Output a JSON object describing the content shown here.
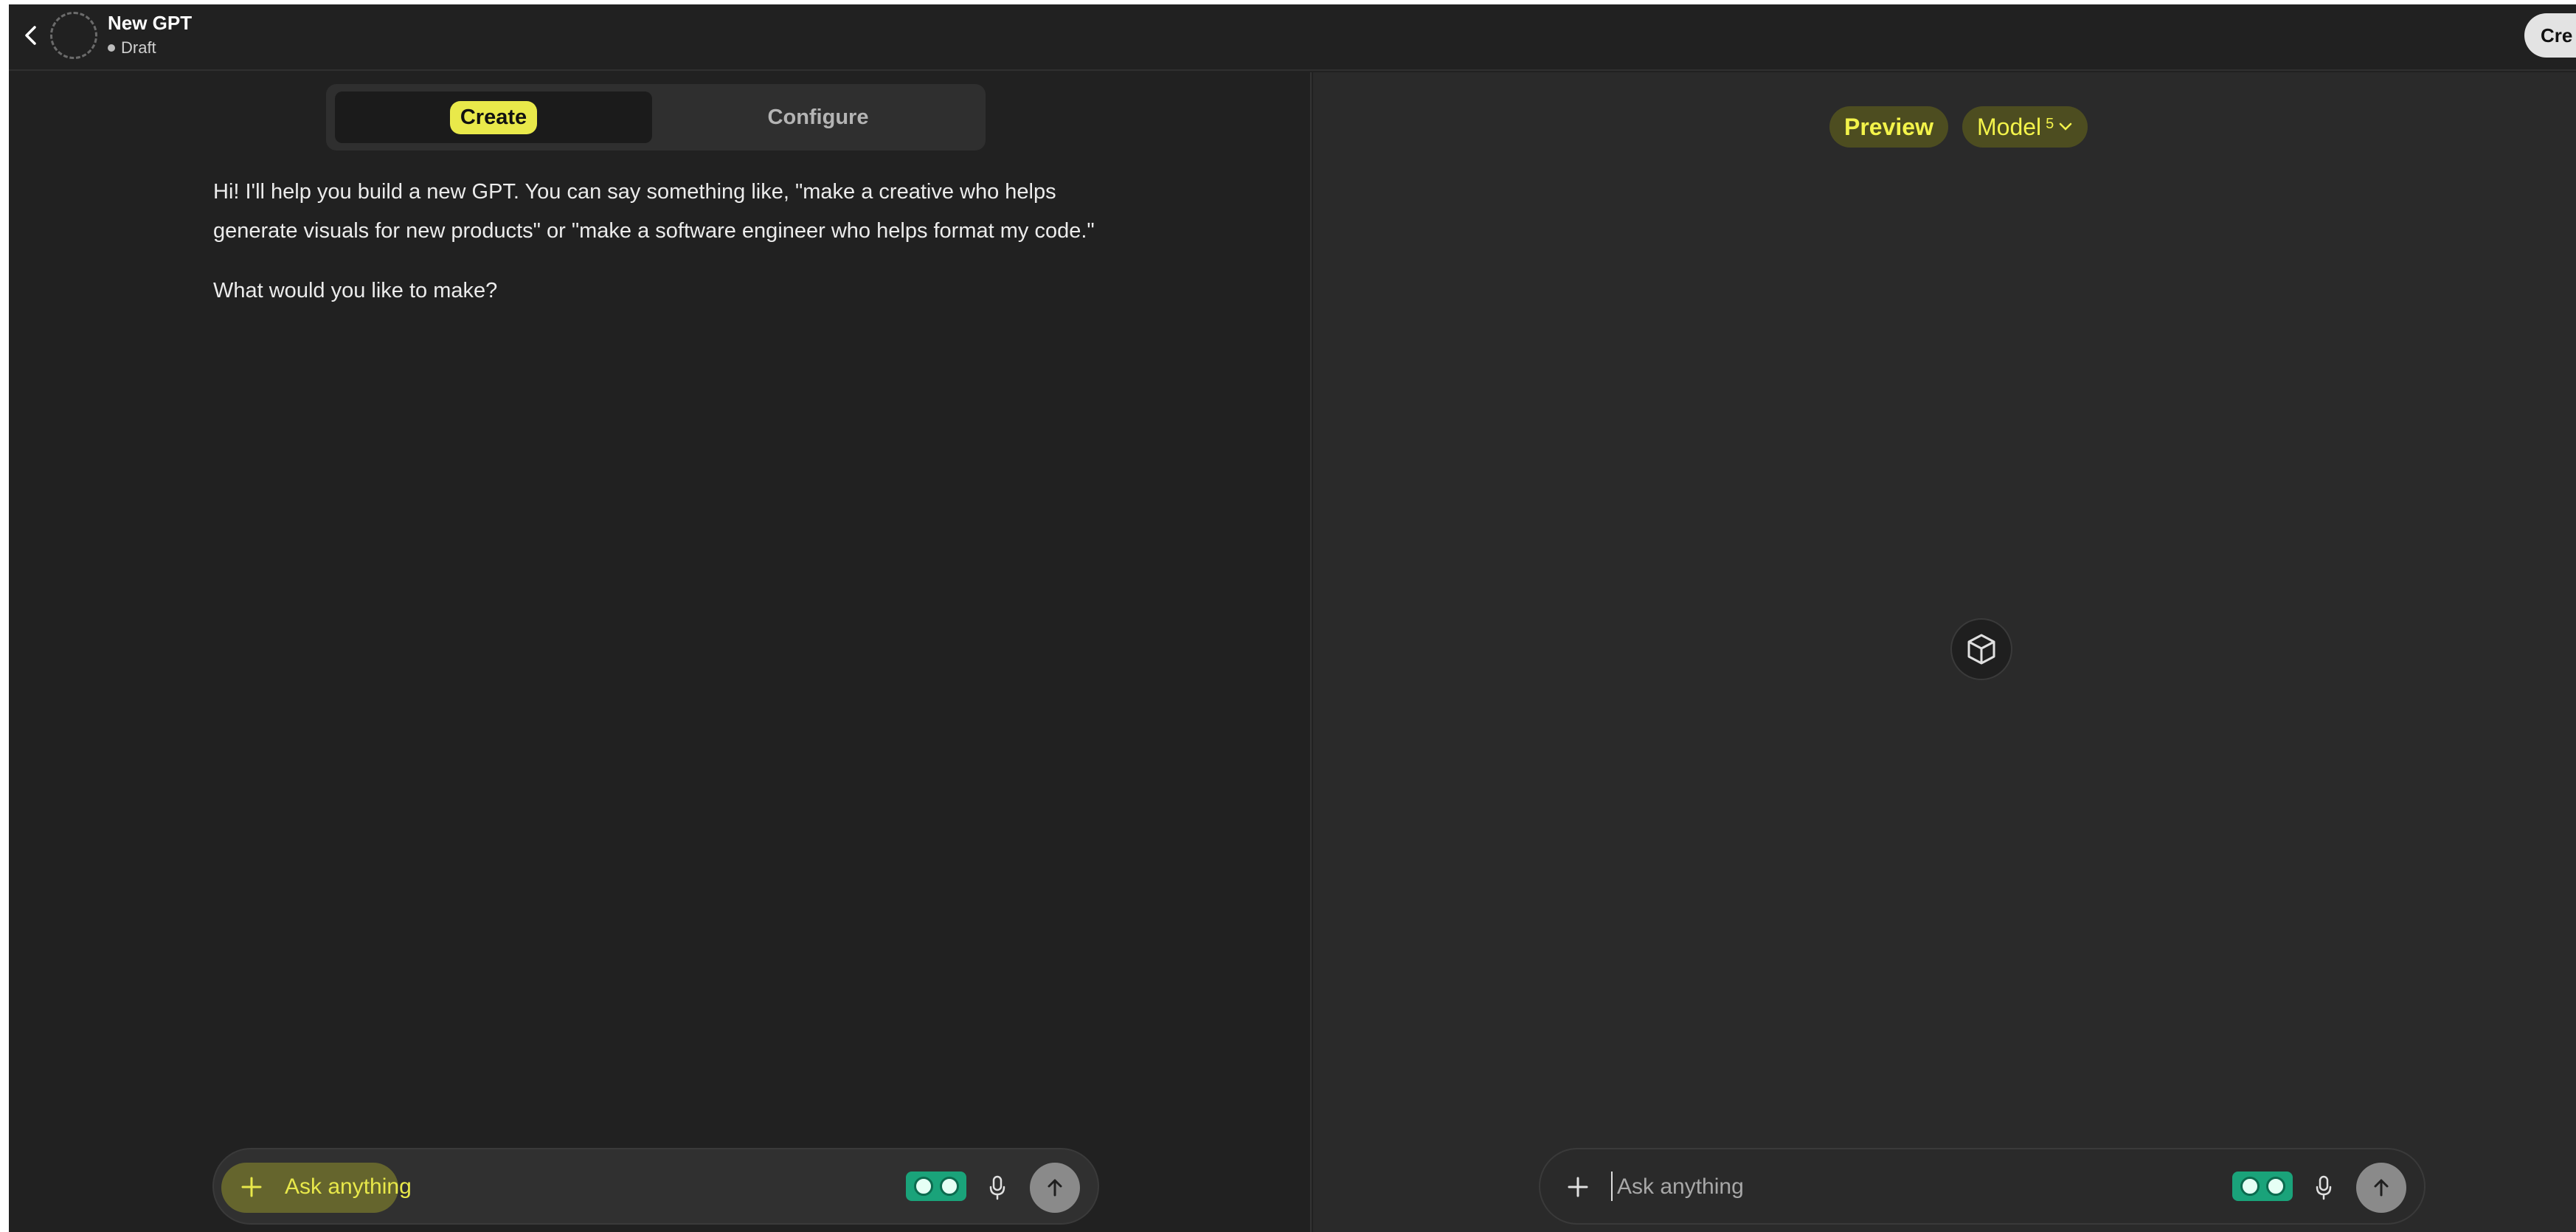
{
  "header": {
    "gpt_name": "New GPT",
    "status": "Draft",
    "create_button_label": "Cre"
  },
  "left_panel": {
    "tabs": [
      {
        "label": "Create",
        "selected": true
      },
      {
        "label": "Configure",
        "selected": false
      }
    ],
    "intro_message": "Hi! I'll help you build a new GPT. You can say something like, \"make a creative who helps generate visuals for new products\" or \"make a software engineer who helps format my code.\"",
    "intro_question": "What would you like to make?",
    "composer": {
      "placeholder": "Ask anything",
      "value": ""
    }
  },
  "right_panel": {
    "preview_label": "Preview",
    "model_label": "Model",
    "model_version": "5",
    "composer": {
      "placeholder": "Ask anything",
      "value": ""
    }
  },
  "icons": {
    "back": "chevron-left-icon",
    "plus": "plus-icon",
    "extension": "grammarly-extension-icon",
    "mic": "microphone-icon",
    "send": "arrow-up-icon",
    "gpt_placeholder": "cube-icon",
    "model_dropdown": "chevron-down-icon"
  },
  "colors": {
    "background": "#212121",
    "preview_background": "#2a2a2a",
    "highlight": "#e9e94a",
    "extension": "#1aa37a"
  }
}
